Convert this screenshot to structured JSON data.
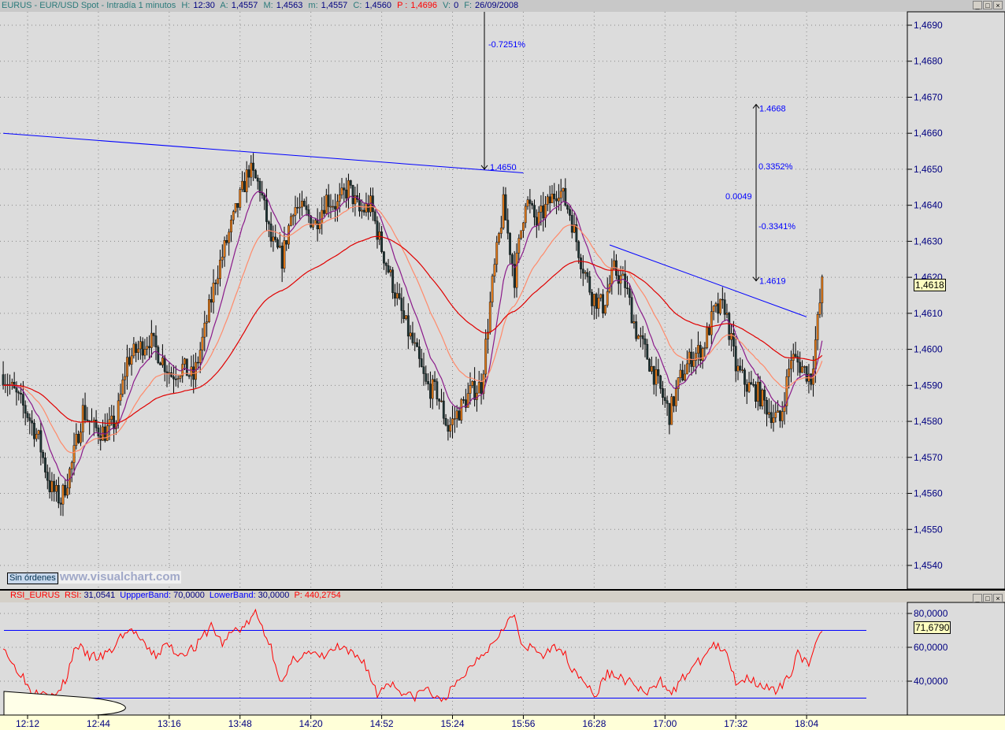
{
  "header": {
    "symbol": "EURUS - EUR/USD Spot - Intradía 1 minutos",
    "h_label": "H:",
    "h": "12:30",
    "a_label": "A:",
    "a": "1,4557",
    "m_label": "M:",
    "m": "1,4563",
    "lo_label": "m:",
    "lo": "1,4557",
    "c_label": "C:",
    "c": "1,4560",
    "p_label": "P :",
    "p": "1,4696",
    "v_label": "V:",
    "v": "0",
    "f_label": "F:",
    "f": "26/09/2008"
  },
  "window_buttons": [
    "_",
    "□",
    "×"
  ],
  "orders_button": "Sin órdenes",
  "watermark": "www.visualchart.com",
  "rsi_header": {
    "name": "RSI_EURUS",
    "rsi_label": "RSI:",
    "rsi": "31,0541",
    "upper_label": "UppperBand:",
    "upper": "70,0000",
    "lower_label": "LowerBand:",
    "lower": "30,0000",
    "p_label": "P:",
    "p": "440,2754"
  },
  "colors": {
    "up_candle": "#e07818",
    "down_candle": "#1e3434",
    "ma_fast": "#8a1a8a",
    "ma_mid": "#ff8a6a",
    "ma_slow": "#e00000",
    "trendline": "#0000ff",
    "rsi": "#ff0000",
    "bands": "#0000ff",
    "axis_text": "#000080"
  },
  "chart_data": [
    {
      "type": "candlestick",
      "interval": "1 minuto",
      "x_ticks": [
        "12:12",
        "12:44",
        "13:16",
        "13:48",
        "14:20",
        "14:52",
        "15:24",
        "15:56",
        "16:28",
        "17:00",
        "17:32",
        "18:04"
      ],
      "y_ticks": [
        "1,4690",
        "1,4680",
        "1,4670",
        "1,4660",
        "1,4650",
        "1,4640",
        "1,4630",
        "1,4620",
        "1,4610",
        "1,4600",
        "1,4590",
        "1,4580",
        "1,4570",
        "1,4560",
        "1,4550",
        "1,4540"
      ],
      "ylim": [
        1.4535,
        1.4694
      ],
      "last_price": "1,4618",
      "close_path": [
        [
          "12:01",
          1.4593
        ],
        [
          "12:06",
          1.4588
        ],
        [
          "12:12",
          1.4582
        ],
        [
          "12:17",
          1.4575
        ],
        [
          "12:22",
          1.4562
        ],
        [
          "12:27",
          1.4558
        ],
        [
          "12:32",
          1.4568
        ],
        [
          "12:37",
          1.4583
        ],
        [
          "12:42",
          1.4578
        ],
        [
          "12:47",
          1.4577
        ],
        [
          "12:52",
          1.458
        ],
        [
          "12:57",
          1.4597
        ],
        [
          "13:02",
          1.46
        ],
        [
          "13:07",
          1.4603
        ],
        [
          "13:12",
          1.4598
        ],
        [
          "13:17",
          1.4593
        ],
        [
          "13:22",
          1.4595
        ],
        [
          "13:27",
          1.4592
        ],
        [
          "13:32",
          1.4605
        ],
        [
          "13:37",
          1.462
        ],
        [
          "13:42",
          1.463
        ],
        [
          "13:47",
          1.464
        ],
        [
          "13:52",
          1.465
        ],
        [
          "13:57",
          1.4645
        ],
        [
          "14:02",
          1.463
        ],
        [
          "14:07",
          1.4625
        ],
        [
          "14:12",
          1.464
        ],
        [
          "14:17",
          1.4638
        ],
        [
          "14:22",
          1.4635
        ],
        [
          "14:27",
          1.4642
        ],
        [
          "14:32",
          1.464
        ],
        [
          "14:37",
          1.4645
        ],
        [
          "14:42",
          1.4638
        ],
        [
          "14:47",
          1.464
        ],
        [
          "14:52",
          1.4628
        ],
        [
          "14:57",
          1.4618
        ],
        [
          "15:02",
          1.4608
        ],
        [
          "15:07",
          1.46
        ],
        [
          "15:12",
          1.459
        ],
        [
          "15:17",
          1.4588
        ],
        [
          "15:22",
          1.4578
        ],
        [
          "15:27",
          1.4583
        ],
        [
          "15:32",
          1.4588
        ],
        [
          "15:37",
          1.459
        ],
        [
          "15:42",
          1.4618
        ],
        [
          "15:47",
          1.464
        ],
        [
          "15:52",
          1.462
        ],
        [
          "15:57",
          1.4642
        ],
        [
          "16:02",
          1.4635
        ],
        [
          "16:07",
          1.464
        ],
        [
          "16:12",
          1.4645
        ],
        [
          "16:17",
          1.4638
        ],
        [
          "16:22",
          1.4625
        ],
        [
          "16:27",
          1.4615
        ],
        [
          "16:32",
          1.4612
        ],
        [
          "16:37",
          1.4622
        ],
        [
          "16:42",
          1.4618
        ],
        [
          "16:47",
          1.4605
        ],
        [
          "16:52",
          1.4598
        ],
        [
          "16:57",
          1.459
        ],
        [
          "17:02",
          1.4582
        ],
        [
          "17:07",
          1.4592
        ],
        [
          "17:12",
          1.4598
        ],
        [
          "17:17",
          1.46
        ],
        [
          "17:22",
          1.461
        ],
        [
          "17:27",
          1.4612
        ],
        [
          "17:32",
          1.4595
        ],
        [
          "17:37",
          1.459
        ],
        [
          "17:42",
          1.4588
        ],
        [
          "17:47",
          1.4583
        ],
        [
          "17:52",
          1.458
        ],
        [
          "17:57",
          1.4598
        ],
        [
          "18:02",
          1.4595
        ],
        [
          "18:06",
          1.4592
        ],
        [
          "18:11",
          1.4618
        ]
      ],
      "trendlines": [
        {
          "from": [
            "12:01",
            1.466
          ],
          "to": [
            "15:56",
            1.4649
          ]
        },
        {
          "from": [
            "16:35",
            1.4629
          ],
          "to": [
            "18:04",
            1.4609
          ]
        }
      ],
      "annotations": [
        {
          "text": "-0.7251%",
          "kind": "pct"
        },
        {
          "text": "1.4650",
          "kind": "level"
        },
        {
          "text": "1.4668",
          "kind": "level"
        },
        {
          "text": "0.3352%",
          "kind": "pct"
        },
        {
          "text": "0.0049",
          "kind": "diff"
        },
        {
          "text": "-0.3341%",
          "kind": "pct"
        },
        {
          "text": "1.4619",
          "kind": "level"
        }
      ]
    },
    {
      "type": "line",
      "name": "RSI_EURUS",
      "y_ticks": [
        "80,0000",
        "60,0000",
        "40,0000"
      ],
      "bands": [
        70,
        30
      ],
      "last_value": "71,6790",
      "values": [
        [
          "12:01",
          62
        ],
        [
          "12:05",
          50
        ],
        [
          "12:09",
          45
        ],
        [
          "12:14",
          33
        ],
        [
          "12:19",
          36
        ],
        [
          "12:24",
          30
        ],
        [
          "12:29",
          40
        ],
        [
          "12:34",
          62
        ],
        [
          "12:39",
          55
        ],
        [
          "12:45",
          54
        ],
        [
          "12:50",
          58
        ],
        [
          "12:55",
          68
        ],
        [
          "13:00",
          70
        ],
        [
          "13:05",
          60
        ],
        [
          "13:10",
          55
        ],
        [
          "13:15",
          62
        ],
        [
          "13:20",
          56
        ],
        [
          "13:28",
          60
        ],
        [
          "13:35",
          73
        ],
        [
          "13:40",
          62
        ],
        [
          "13:45",
          70
        ],
        [
          "13:50",
          72
        ],
        [
          "13:55",
          80
        ],
        [
          "13:58",
          72
        ],
        [
          "14:02",
          60
        ],
        [
          "14:07",
          38
        ],
        [
          "14:12",
          52
        ],
        [
          "14:17",
          57
        ],
        [
          "14:25",
          54
        ],
        [
          "14:32",
          60
        ],
        [
          "14:38",
          56
        ],
        [
          "14:44",
          52
        ],
        [
          "14:50",
          32
        ],
        [
          "14:55",
          40
        ],
        [
          "15:00",
          35
        ],
        [
          "15:06",
          30
        ],
        [
          "15:12",
          36
        ],
        [
          "15:18",
          28
        ],
        [
          "15:24",
          35
        ],
        [
          "15:30",
          45
        ],
        [
          "15:36",
          55
        ],
        [
          "15:42",
          62
        ],
        [
          "15:48",
          75
        ],
        [
          "15:52",
          78
        ],
        [
          "15:56",
          58
        ],
        [
          "16:00",
          60
        ],
        [
          "16:06",
          55
        ],
        [
          "16:12",
          62
        ],
        [
          "16:18",
          48
        ],
        [
          "16:24",
          40
        ],
        [
          "16:28",
          30
        ],
        [
          "16:34",
          45
        ],
        [
          "16:40",
          42
        ],
        [
          "16:46",
          38
        ],
        [
          "16:52",
          32
        ],
        [
          "16:58",
          40
        ],
        [
          "17:04",
          34
        ],
        [
          "17:10",
          45
        ],
        [
          "17:16",
          52
        ],
        [
          "17:22",
          62
        ],
        [
          "17:28",
          55
        ],
        [
          "17:32",
          40
        ],
        [
          "17:38",
          42
        ],
        [
          "17:44",
          38
        ],
        [
          "17:50",
          33
        ],
        [
          "17:56",
          42
        ],
        [
          "18:00",
          58
        ],
        [
          "18:05",
          48
        ],
        [
          "18:11",
          72
        ]
      ]
    }
  ]
}
